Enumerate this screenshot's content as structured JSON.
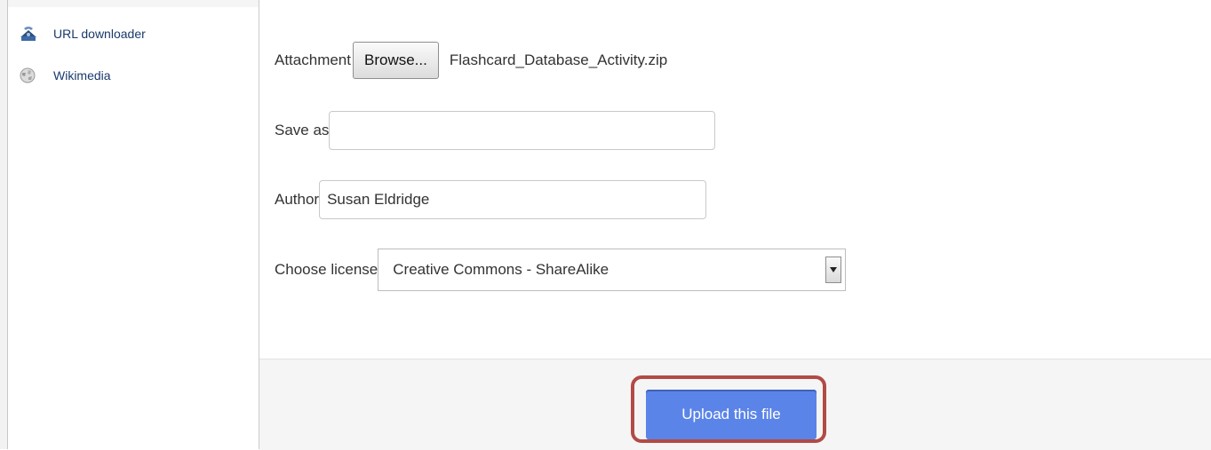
{
  "sidebar": {
    "items": [
      {
        "label": "URL downloader",
        "icon": "url-downloader-icon"
      },
      {
        "label": "Wikimedia",
        "icon": "wikimedia-globe-icon"
      }
    ]
  },
  "form": {
    "attachment_label": "Attachment",
    "browse_label": "Browse...",
    "file_name": "Flashcard_Database_Activity.zip",
    "saveas_label": "Save as",
    "saveas_value": "",
    "author_label": "Author",
    "author_value": "Susan Eldridge",
    "license_label": "Choose license",
    "license_selected": "Creative Commons - ShareAlike"
  },
  "footer": {
    "upload_label": "Upload this file"
  },
  "colors": {
    "accent": "#5b84e8",
    "highlight": "#b24a46",
    "link": "#1a3a6b"
  }
}
